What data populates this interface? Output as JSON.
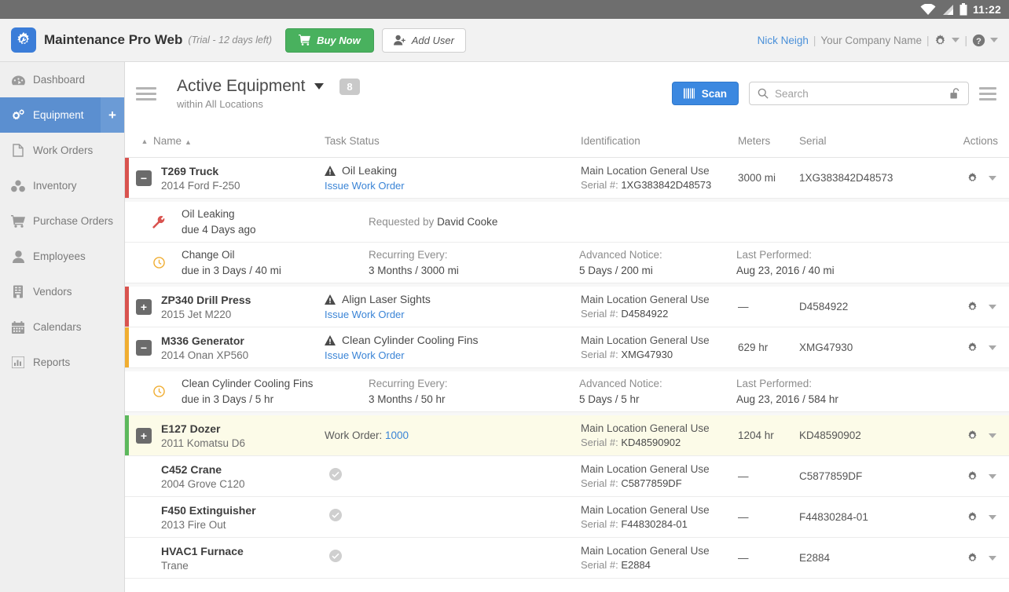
{
  "statusbar": {
    "time": "11:22",
    "icons": [
      "wifi-icon",
      "signal-icon",
      "battery-icon"
    ]
  },
  "appbar": {
    "logo_icon": "app-logo-gear-icon",
    "title": "Maintenance Pro Web",
    "trial": "(Trial - 12 days left)",
    "buy_label": "Buy Now",
    "buy_icon": "cart-icon",
    "buy_color": "#49b15e",
    "adduser_label": "Add User",
    "adduser_icon": "add-user-icon",
    "user": "Nick Neigh",
    "sep1": "|",
    "company": "Your Company Name",
    "sep2": "|",
    "gear_icon": "gear-icon",
    "help_icon": "help-icon",
    "user_link_color": "#4a90d9"
  },
  "sidebar": {
    "items": [
      {
        "label": "Dashboard",
        "icon": "dashboard-icon",
        "active": false
      },
      {
        "label": "Equipment",
        "icon": "gears-icon",
        "active": true
      },
      {
        "label": "Work Orders",
        "icon": "document-icon",
        "active": false
      },
      {
        "label": "Inventory",
        "icon": "boxes-icon",
        "active": false
      },
      {
        "label": "Purchase Orders",
        "icon": "cart-icon",
        "active": false
      },
      {
        "label": "Employees",
        "icon": "person-icon",
        "active": false
      },
      {
        "label": "Vendors",
        "icon": "building-icon",
        "active": false
      },
      {
        "label": "Calendars",
        "icon": "calendar-icon",
        "active": false
      },
      {
        "label": "Reports",
        "icon": "bar-chart-icon",
        "active": false
      }
    ],
    "add_label": "+",
    "active_color": "#5b8fd0"
  },
  "toolbar": {
    "menu_icon": "hamburger-icon",
    "page_title": "Active Equipment",
    "dropdown_icon": "chevron-down-icon",
    "count": "8",
    "subtitle": "within All Locations",
    "scan_label": "Scan",
    "scan_icon": "barcode-icon",
    "scan_color": "#3b88e0",
    "search_placeholder": "Search",
    "search_value": "",
    "search_icon": "search-icon",
    "lock_icon": "unlock-icon",
    "list_menu_icon": "list-menu-icon"
  },
  "table": {
    "headers": {
      "sort_mark": "▲",
      "name": "Name",
      "name_sort": "▲",
      "task_status": "Task Status",
      "identification": "Identification",
      "meters": "Meters",
      "serial": "Serial",
      "actions": "Actions"
    },
    "labels": {
      "serial_prefix": "Serial #: ",
      "work_order_prefix": "Work Order: ",
      "recurring_label": "Recurring Every:",
      "advanced_label": "Advanced Notice:",
      "lastperf_label": "Last Performed:",
      "requested_prefix": "Requested by ",
      "issue_work_order": "Issue Work Order"
    },
    "status_colors": {
      "red": "#d9534f",
      "orange": "#f0ad31",
      "green": "#5cb85c"
    },
    "rows": [
      {
        "name": "T269 Truck",
        "model": "2014 Ford F-250",
        "status_color": "red",
        "toggle": "minus",
        "task": "Oil Leaking",
        "task_icon": "warning-icon",
        "link": "Issue Work Order",
        "location": "Main Location General Use",
        "serial": "1XG383842D48573",
        "meters": "3000 mi",
        "serial_col": "1XG383842D48573",
        "highlight": false,
        "subrows": [
          {
            "icon": "wrench-icon",
            "icon_color": "#d9534f",
            "c1a": "Oil Leaking",
            "c1b": "due 4 Days ago",
            "requested_by": "David Cooke",
            "type": "request"
          },
          {
            "icon": "clock-icon",
            "icon_color": "#f0ad31",
            "c1a": "Change Oil",
            "c1b": "due in 3 Days / 40 mi",
            "recurring": "3 Months / 3000 mi",
            "advanced": "5 Days / 200 mi",
            "lastperf": "Aug 23, 2016 / 40 mi",
            "type": "task"
          }
        ]
      },
      {
        "name": "ZP340 Drill Press",
        "model": "2015 Jet M220",
        "status_color": "red",
        "toggle": "plus",
        "task": "Align Laser Sights",
        "task_icon": "warning-icon",
        "link": "Issue Work Order",
        "location": "Main Location General Use",
        "serial": "D4584922",
        "meters": "—",
        "serial_col": "D4584922",
        "highlight": false,
        "subrows": []
      },
      {
        "name": "M336 Generator",
        "model": "2014 Onan XP560",
        "status_color": "orange",
        "toggle": "minus",
        "task": "Clean Cylinder Cooling Fins",
        "task_icon": "warning-icon",
        "link": "Issue Work Order",
        "location": "Main Location General Use",
        "serial": "XMG47930",
        "meters": "629 hr",
        "serial_col": "XMG47930",
        "highlight": false,
        "subrows": [
          {
            "icon": "clock-icon",
            "icon_color": "#f0ad31",
            "c1a": "Clean Cylinder Cooling Fins",
            "c1b": "due in 3 Days / 5 hr",
            "recurring": "3 Months / 50 hr",
            "advanced": "5 Days / 5 hr",
            "lastperf": "Aug 23, 2016 / 584 hr",
            "type": "task"
          }
        ]
      },
      {
        "name": "E127 Dozer",
        "model": "2011 Komatsu D6",
        "status_color": "green",
        "toggle": "plus",
        "work_order": "1000",
        "location": "Main Location General Use",
        "serial": "KD48590902",
        "meters": "1204 hr",
        "serial_col": "KD48590902",
        "highlight": true,
        "subrows": []
      },
      {
        "name": "C452 Crane",
        "model": "2004 Grove C120",
        "status_color": "none",
        "toggle": "none",
        "task_icon": "check-circle-icon",
        "location": "Main Location General Use",
        "serial": "C5877859DF",
        "meters": "—",
        "serial_col": "C5877859DF",
        "highlight": false,
        "subrows": []
      },
      {
        "name": "F450 Extinguisher",
        "model": "2013 Fire Out",
        "status_color": "none",
        "toggle": "none",
        "task_icon": "check-circle-icon",
        "location": "Main Location General Use",
        "serial": "F44830284-01",
        "meters": "—",
        "serial_col": "F44830284-01",
        "highlight": false,
        "subrows": []
      },
      {
        "name": "HVAC1 Furnace",
        "model": "Trane",
        "status_color": "none",
        "toggle": "none",
        "task_icon": "check-circle-icon",
        "location": "Main Location General Use",
        "serial": "E2884",
        "meters": "—",
        "serial_col": "E2884",
        "highlight": false,
        "subrows": []
      }
    ]
  }
}
